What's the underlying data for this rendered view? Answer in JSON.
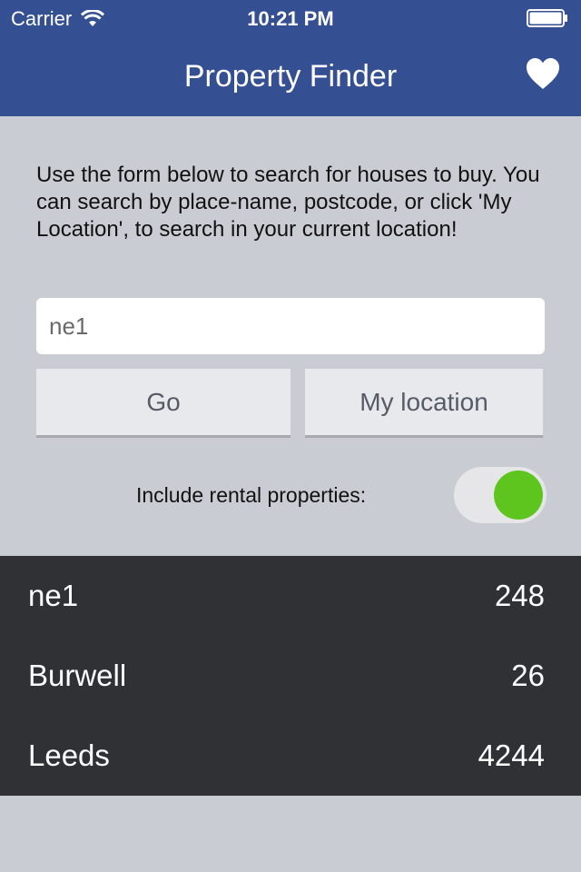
{
  "status_bar": {
    "carrier": "Carrier",
    "time": "10:21 PM"
  },
  "navbar": {
    "title": "Property Finder",
    "favorites_icon": "heart-icon"
  },
  "form": {
    "instructions": "Use the form below to search for houses to buy. You can search by place-name, postcode, or click 'My Location', to search in your current location!",
    "search_value": "ne1",
    "go_label": "Go",
    "my_location_label": "My location",
    "toggle_label": "Include rental properties:",
    "toggle_on": true
  },
  "results": [
    {
      "place": "ne1",
      "count": "248"
    },
    {
      "place": "Burwell",
      "count": "26"
    },
    {
      "place": "Leeds",
      "count": "4244"
    }
  ],
  "colors": {
    "navbar": "#354f93",
    "background": "#c9ccd3",
    "results_bg": "#303135",
    "toggle_on": "#5ec51e"
  }
}
